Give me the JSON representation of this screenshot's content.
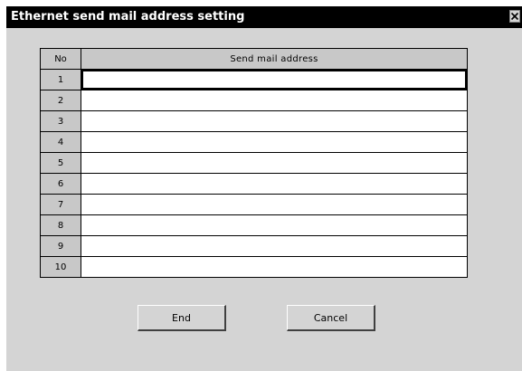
{
  "window": {
    "title": "Ethernet send mail address setting",
    "close_icon": "close-icon"
  },
  "table": {
    "headers": {
      "no": "No",
      "address": "Send mail address"
    },
    "rows": [
      {
        "no": "1",
        "address": ""
      },
      {
        "no": "2",
        "address": ""
      },
      {
        "no": "3",
        "address": ""
      },
      {
        "no": "4",
        "address": ""
      },
      {
        "no": "5",
        "address": ""
      },
      {
        "no": "6",
        "address": ""
      },
      {
        "no": "7",
        "address": ""
      },
      {
        "no": "8",
        "address": ""
      },
      {
        "no": "9",
        "address": ""
      },
      {
        "no": "10",
        "address": ""
      }
    ],
    "active_row": 1
  },
  "buttons": {
    "end_label": "End",
    "cancel_label": "Cancel"
  },
  "colors": {
    "titlebar": "#000000",
    "title_text": "#ffffff",
    "client_bg": "#d4d4d4",
    "header_cell_bg": "#c8c8c8",
    "input_bg": "#ffffff"
  }
}
